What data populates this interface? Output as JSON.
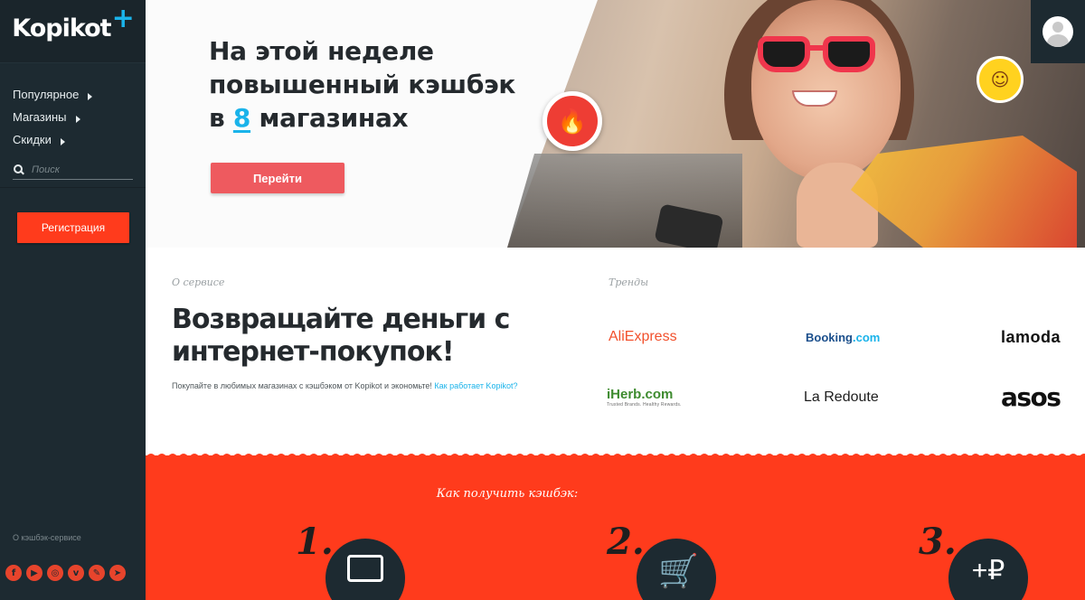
{
  "brand": {
    "name": "Kopikot",
    "plus": "+"
  },
  "sidebar": {
    "items": [
      {
        "label": "Популярное"
      },
      {
        "label": "Магазины"
      },
      {
        "label": "Скидки"
      }
    ],
    "search_placeholder": "Поиск",
    "register_label": "Регистрация",
    "about_service": "О кэшбэк-сервисе",
    "socials": [
      "facebook-icon",
      "youtube-icon",
      "instagram-icon",
      "vk-icon",
      "pen-icon",
      "telegram-icon"
    ]
  },
  "hero": {
    "line1": "На этой неделе",
    "line2": "повышенный кэшбэк",
    "line3_pre": "в",
    "line3_num": "8",
    "line3_post": "магазинах",
    "button": "Перейти"
  },
  "about": {
    "label": "О сервисе",
    "title": "Возвращайте деньги с интернет-покупок!",
    "text": "Покупайте в любимых магазинах с кэшбэком от Kopikot и экономьте!",
    "link": "Как работает Kopikot?"
  },
  "trends": {
    "label": "Тренды",
    "brands": [
      {
        "name": "AliExpress"
      },
      {
        "name": "Booking",
        "suffix": ".com"
      },
      {
        "name": "lamoda"
      },
      {
        "name": "iHerb.com",
        "tagline": "Trusted Brands. Healthy Rewards."
      },
      {
        "name": "La Redoute"
      },
      {
        "name": "asos"
      }
    ]
  },
  "how": {
    "title": "Как получить кэшбэк:",
    "steps": [
      {
        "num": "1.",
        "icon": "monitor-icon"
      },
      {
        "num": "2.",
        "icon": "cart-icon"
      },
      {
        "num": "3.",
        "icon": "plus-ruble-icon",
        "glyph": "+₽"
      }
    ]
  },
  "colors": {
    "sidebar": "#1d2a31",
    "accent_red": "#ff3b1c",
    "accent_blue": "#1ab3ea",
    "button_pink": "#ee5a5f"
  }
}
